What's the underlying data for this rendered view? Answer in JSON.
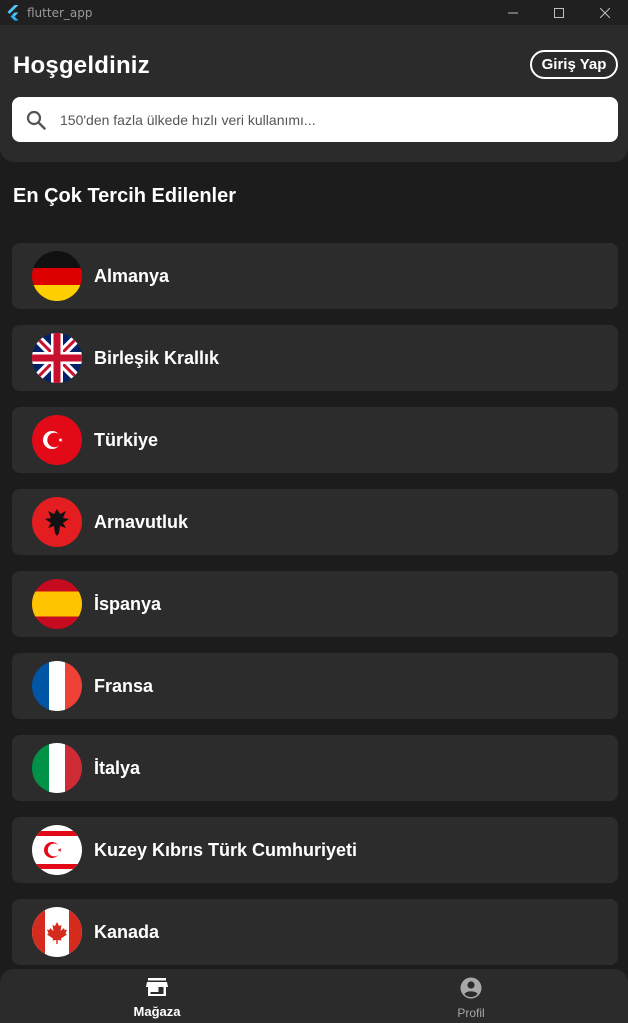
{
  "window": {
    "title": "flutter_app"
  },
  "header": {
    "welcome": "Hoşgeldiniz",
    "login_label": "Giriş Yap",
    "search_placeholder": "150'den fazla ülkede hızlı veri kullanımı..."
  },
  "section_title": "En Çok Tercih Edilenler",
  "countries": [
    {
      "name": "Almanya",
      "flag": "germany"
    },
    {
      "name": "Birleşik Krallık",
      "flag": "united-kingdom"
    },
    {
      "name": "Türkiye",
      "flag": "turkey"
    },
    {
      "name": "Arnavutluk",
      "flag": "albania"
    },
    {
      "name": "İspanya",
      "flag": "spain"
    },
    {
      "name": "Fransa",
      "flag": "france"
    },
    {
      "name": "İtalya",
      "flag": "italy"
    },
    {
      "name": "Kuzey Kıbrıs Türk Cumhuriyeti",
      "flag": "northern-cyprus"
    },
    {
      "name": "Kanada",
      "flag": "canada"
    }
  ],
  "nav": {
    "store_label": "Mağaza",
    "profile_label": "Profil",
    "store_icon": "store-icon",
    "profile_icon": "account-circle-icon"
  },
  "colors": {
    "background": "#1c1c1c",
    "surface": "#2b2b2b",
    "card": "#2c2c2c",
    "accent_text": "#ffffff"
  }
}
